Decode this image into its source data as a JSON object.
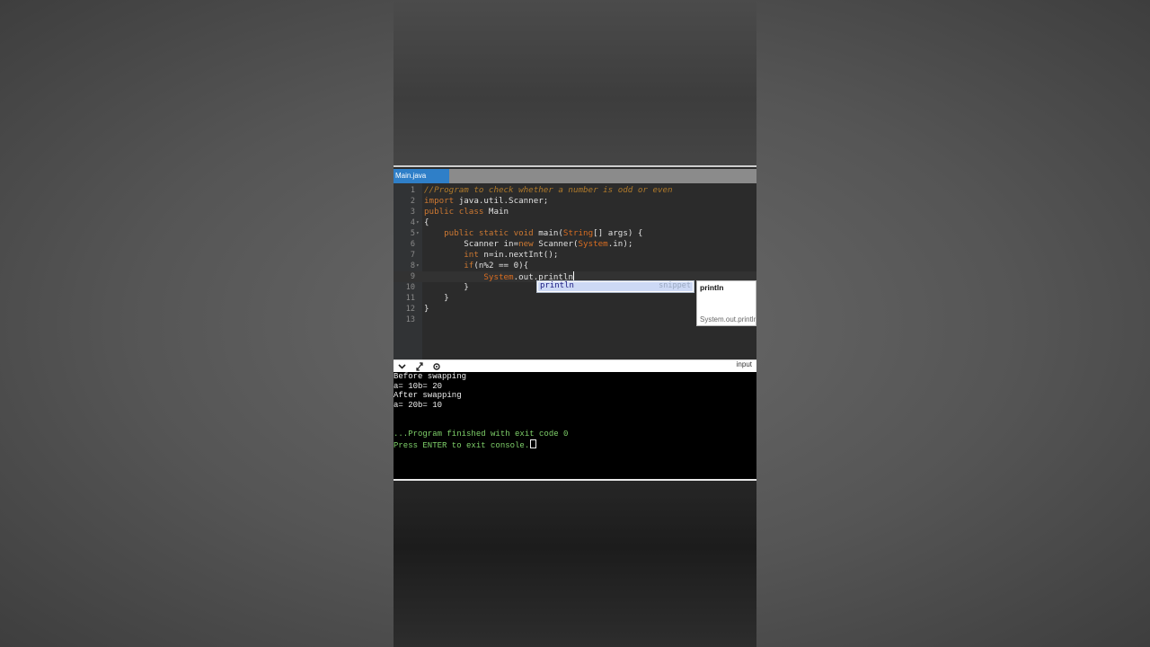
{
  "editor": {
    "tab_label": "Main.java",
    "lines": [
      {
        "num": "1",
        "fold": "",
        "parts": [
          {
            "t": "//Program to check whether a number is odd or even",
            "c": "cm"
          }
        ]
      },
      {
        "num": "2",
        "fold": "",
        "parts": [
          {
            "t": "import",
            "c": "kw"
          },
          {
            "t": " java.util.Scanner;",
            "c": ""
          }
        ]
      },
      {
        "num": "3",
        "fold": "",
        "parts": [
          {
            "t": "public class",
            "c": "kw"
          },
          {
            "t": " Main",
            "c": ""
          }
        ]
      },
      {
        "num": "4",
        "fold": "▾",
        "parts": [
          {
            "t": "{",
            "c": ""
          }
        ]
      },
      {
        "num": "5",
        "fold": "▾",
        "parts": [
          {
            "t": "    ",
            "c": ""
          },
          {
            "t": "public static void",
            "c": "kw"
          },
          {
            "t": " main(",
            "c": ""
          },
          {
            "t": "String",
            "c": "sysc"
          },
          {
            "t": "[] args) {",
            "c": ""
          }
        ]
      },
      {
        "num": "6",
        "fold": "",
        "parts": [
          {
            "t": "        Scanner in=",
            "c": ""
          },
          {
            "t": "new",
            "c": "kw"
          },
          {
            "t": " Scanner(",
            "c": ""
          },
          {
            "t": "System",
            "c": "sysc"
          },
          {
            "t": ".in);",
            "c": ""
          }
        ]
      },
      {
        "num": "7",
        "fold": "",
        "parts": [
          {
            "t": "        ",
            "c": ""
          },
          {
            "t": "int",
            "c": "kw"
          },
          {
            "t": " n=in.nextInt();",
            "c": ""
          }
        ]
      },
      {
        "num": "8",
        "fold": "▾",
        "parts": [
          {
            "t": "        ",
            "c": ""
          },
          {
            "t": "if",
            "c": "kw"
          },
          {
            "t": "(n%2 == 0){",
            "c": ""
          }
        ]
      },
      {
        "num": "9",
        "fold": "",
        "parts": [
          {
            "t": "            ",
            "c": ""
          },
          {
            "t": "System",
            "c": "sysc"
          },
          {
            "t": ".out.println",
            "c": ""
          }
        ],
        "current": true
      },
      {
        "num": "10",
        "fold": "",
        "parts": [
          {
            "t": "        }",
            "c": ""
          }
        ]
      },
      {
        "num": "11",
        "fold": "",
        "parts": [
          {
            "t": "    }",
            "c": ""
          }
        ]
      },
      {
        "num": "12",
        "fold": "",
        "parts": [
          {
            "t": "}",
            "c": ""
          }
        ]
      },
      {
        "num": "13",
        "fold": "",
        "parts": []
      }
    ]
  },
  "autocomplete": {
    "item": "println",
    "kind": "snippet",
    "doc_title": "println",
    "doc_signature": "System.out.println"
  },
  "console": {
    "input_label": "input",
    "output": [
      "Before swapping",
      "a= 10b= 20",
      "After swapping",
      "a= 20b= 10"
    ],
    "finished": "...Program finished with exit code 0",
    "press_enter": "Press ENTER to exit console."
  },
  "icons": [
    "chevron-down-icon",
    "expand-icon",
    "settings-icon"
  ]
}
